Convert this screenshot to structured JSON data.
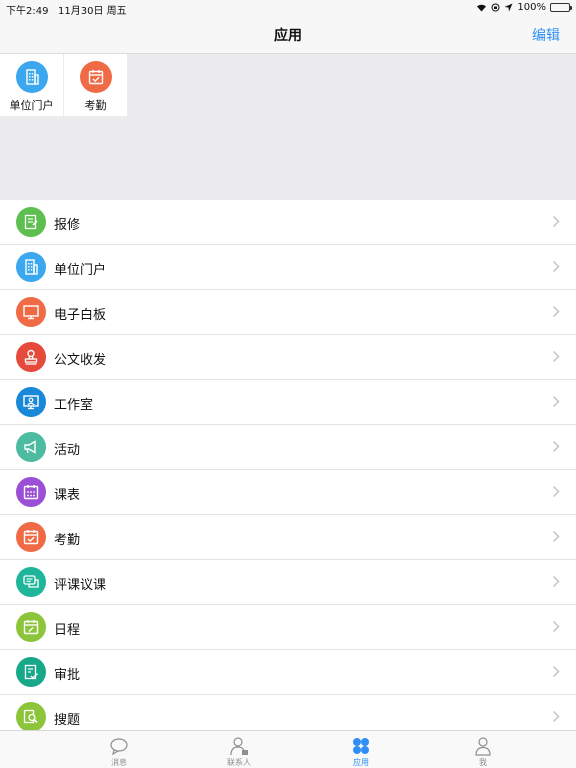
{
  "status": {
    "time": "下午2:49",
    "date": "11月30日 周五",
    "battery_text": "100%"
  },
  "nav": {
    "title": "应用",
    "edit": "编辑"
  },
  "grid": [
    {
      "label": "单位门户",
      "icon": "building-icon",
      "color": "#3aa7ee"
    },
    {
      "label": "考勤",
      "icon": "calendar-check-icon",
      "color": "#f06a45"
    }
  ],
  "list": [
    {
      "label": "报修",
      "icon": "repair-form-icon",
      "color": "#5cbf4f"
    },
    {
      "label": "单位门户",
      "icon": "building-icon",
      "color": "#3aa7ee"
    },
    {
      "label": "电子白板",
      "icon": "monitor-icon",
      "color": "#f06a45"
    },
    {
      "label": "公文收发",
      "icon": "stamp-icon",
      "color": "#e64a3b"
    },
    {
      "label": "工作室",
      "icon": "presenter-icon",
      "color": "#1a88d8"
    },
    {
      "label": "活动",
      "icon": "megaphone-icon",
      "color": "#4dbba0"
    },
    {
      "label": "课表",
      "icon": "timetable-icon",
      "color": "#9b4fd6"
    },
    {
      "label": "考勤",
      "icon": "calendar-check-icon",
      "color": "#f06a45"
    },
    {
      "label": "评课议课",
      "icon": "chat-icon",
      "color": "#1fb59a"
    },
    {
      "label": "日程",
      "icon": "schedule-icon",
      "color": "#8cc43a"
    },
    {
      "label": "审批",
      "icon": "approval-icon",
      "color": "#17a88a"
    },
    {
      "label": "搜题",
      "icon": "search-doc-icon",
      "color": "#8cc43a"
    }
  ],
  "tabs": [
    {
      "label": "消息",
      "icon": "message-icon"
    },
    {
      "label": "联系人",
      "icon": "contacts-icon"
    },
    {
      "label": "应用",
      "icon": "apps-icon",
      "active": true
    },
    {
      "label": "我",
      "icon": "profile-icon"
    }
  ]
}
